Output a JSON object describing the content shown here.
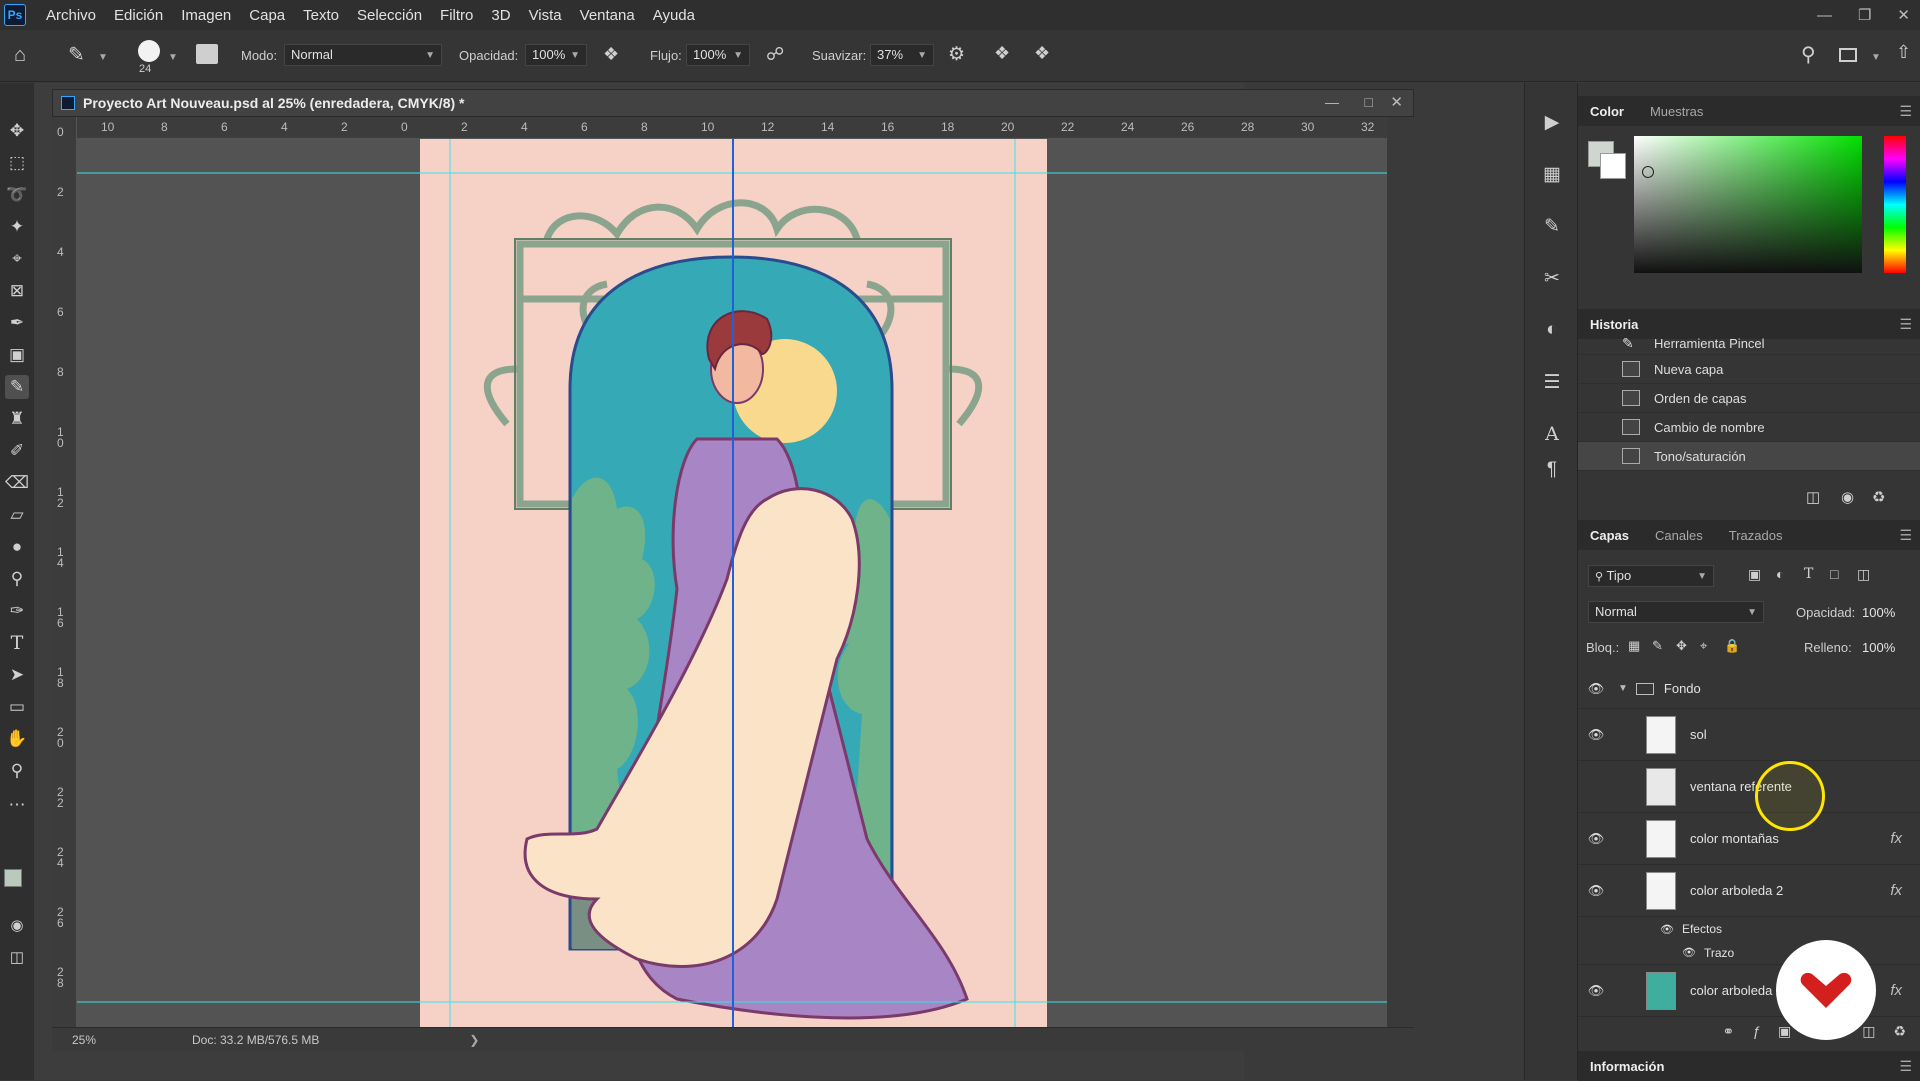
{
  "app": {
    "logo": "Ps",
    "menu": [
      "Archivo",
      "Edición",
      "Imagen",
      "Capa",
      "Texto",
      "Selección",
      "Filtro",
      "3D",
      "Vista",
      "Ventana",
      "Ayuda"
    ]
  },
  "options": {
    "brush_size": "24",
    "mode_label": "Modo:",
    "mode_value": "Normal",
    "opacity_label": "Opacidad:",
    "opacity_value": "100%",
    "flow_label": "Flujo:",
    "flow_value": "100%",
    "smooth_label": "Suavizar:",
    "smooth_value": "37%"
  },
  "document": {
    "title": "Proyecto Art Nouveau.psd al 25% (enredadera, CMYK/8) *",
    "zoom": "25%",
    "doc_info": "Doc: 33.2 MB/576.5 MB",
    "ruler_top": [
      "10",
      "8",
      "6",
      "4",
      "2",
      "0",
      "2",
      "4",
      "6",
      "8",
      "10",
      "12",
      "14",
      "16",
      "18",
      "20",
      "22",
      "24",
      "26",
      "28",
      "30",
      "32"
    ],
    "ruler_left": [
      "0",
      "2",
      "4",
      "6",
      "8",
      "10",
      "12",
      "14",
      "16",
      "18",
      "20",
      "22",
      "24",
      "26",
      "28"
    ]
  },
  "color_panel": {
    "tabs": [
      "Color",
      "Muestras"
    ]
  },
  "history_panel": {
    "title": "Historia",
    "items": [
      "Herramienta Pincel",
      "Nueva capa",
      "Orden de capas",
      "Cambio de nombre",
      "Tono/saturación"
    ]
  },
  "layers_panel": {
    "tabs": [
      "Capas",
      "Canales",
      "Trazados"
    ],
    "filter_label": "Tipo",
    "blend_mode": "Normal",
    "opacity_label": "Opacidad:",
    "opacity_value": "100%",
    "lock_label": "Bloq.:",
    "fill_label": "Relleno:",
    "fill_value": "100%",
    "group_name": "Fondo",
    "layers": [
      {
        "name": "sol",
        "fx": ""
      },
      {
        "name": "ventana referente",
        "fx": ""
      },
      {
        "name": "color montañas",
        "fx": "fx"
      },
      {
        "name": "color arboleda 2",
        "fx": "fx"
      },
      {
        "name": "color arboleda",
        "fx": "fx"
      }
    ],
    "effects_label": "Efectos",
    "stroke_label": "Trazo"
  },
  "info_panel": {
    "title": "Información"
  },
  "colors": {
    "canvas_bg": "#f6d2c6",
    "arch_teal": "#35a9b6",
    "sun": "#f8d98e",
    "dress": "#a885c4",
    "frame_green": "#8aa48d",
    "trees": "#6fb38a",
    "guide_cyan": "#35e4ee",
    "guide_blue": "#1f62d8"
  }
}
